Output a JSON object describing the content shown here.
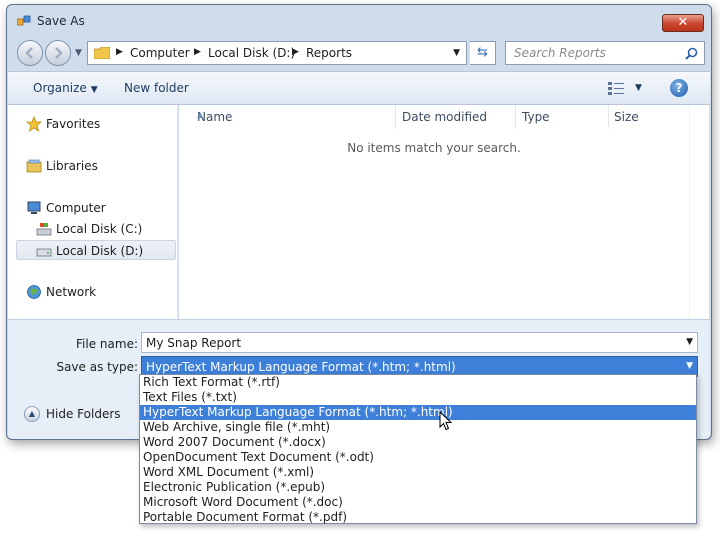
{
  "window": {
    "title": "Save As",
    "close_label": "✕"
  },
  "address": {
    "crumbs": [
      "Computer",
      "Local Disk (D:)",
      "Reports"
    ],
    "search_placeholder": "Search Reports"
  },
  "toolbar": {
    "organize_label": "Organize",
    "new_folder_label": "New folder",
    "help_label": "?"
  },
  "nav_pane": {
    "items": [
      {
        "label": "Favorites",
        "icon": "star-icon"
      },
      {
        "label": "Libraries",
        "icon": "library-icon"
      },
      {
        "label": "Computer",
        "icon": "computer-icon"
      },
      {
        "label": "Local Disk (C:)",
        "icon": "drive-icon"
      },
      {
        "label": "Local Disk (D:)",
        "icon": "drive-icon",
        "selected": true
      },
      {
        "label": "Network",
        "icon": "network-icon"
      }
    ]
  },
  "file_list": {
    "columns": [
      "Name",
      "Date modified",
      "Type",
      "Size"
    ],
    "empty_message": "No items match your search."
  },
  "form": {
    "file_name_label": "File name:",
    "file_name_value": "My Snap Report",
    "save_type_label": "Save as type:",
    "save_type_value": "HyperText Markup Language Format (*.htm; *.html)",
    "hide_folders_label": "Hide Folders"
  },
  "save_type_options": [
    "Rich Text Format (*.rtf)",
    "Text Files (*.txt)",
    "HyperText Markup Language Format (*.htm; *.html)",
    "Web Archive, single file (*.mht)",
    "Word 2007 Document (*.docx)",
    "OpenDocument Text Document (*.odt)",
    "Word XML Document (*.xml)",
    "Electronic Publication (*.epub)",
    "Microsoft Word Document (*.doc)",
    "Portable Document Format (*.pdf)"
  ],
  "selected_option_index": 2,
  "colors": {
    "selection": "#3d7fd9",
    "frame": "#cfdcec",
    "close": "#c9452c"
  }
}
